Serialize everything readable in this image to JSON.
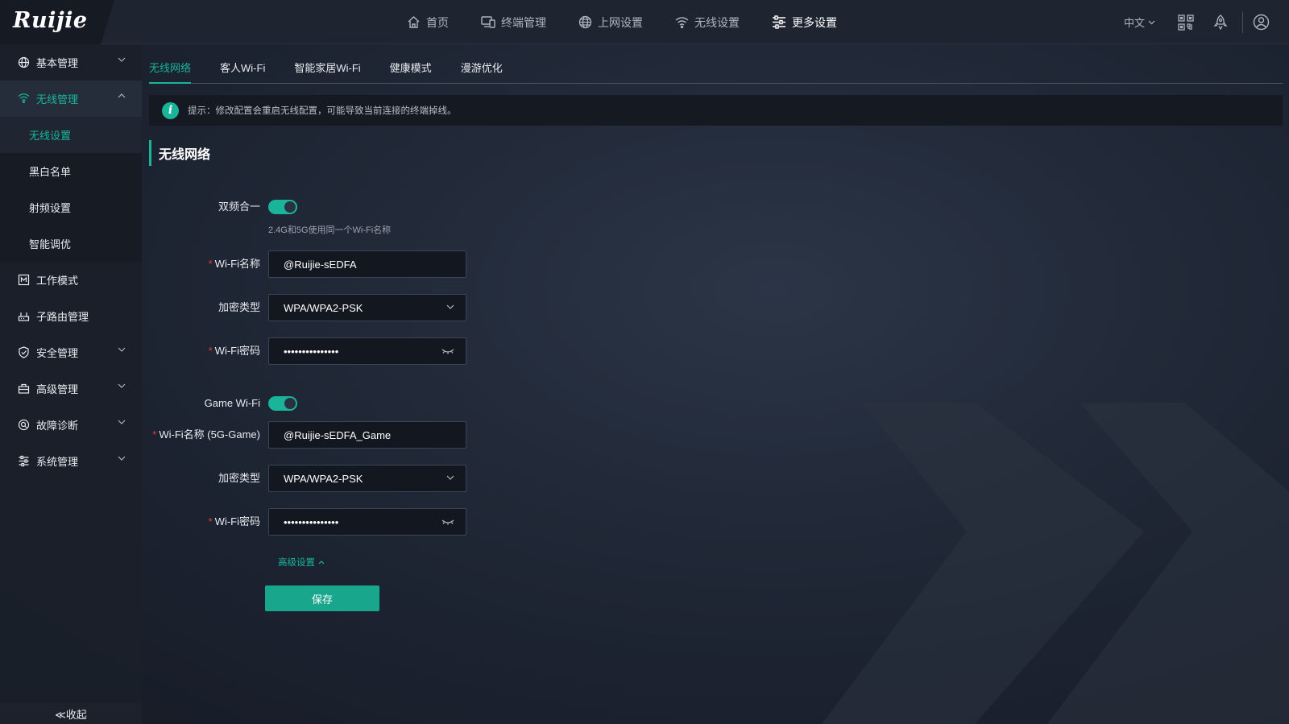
{
  "brand": {
    "logo": "Ruijie"
  },
  "nav": [
    {
      "label": "首页",
      "icon": "home-icon",
      "active": false
    },
    {
      "label": "终端管理",
      "icon": "devices-icon",
      "active": false
    },
    {
      "label": "上网设置",
      "icon": "globe-icon",
      "active": false
    },
    {
      "label": "无线设置",
      "icon": "wifi-icon",
      "active": false
    },
    {
      "label": "更多设置",
      "icon": "settings-sliders-icon",
      "active": true
    }
  ],
  "topright": {
    "language": "中文"
  },
  "sidebar": {
    "items": [
      {
        "label": "基本管理",
        "icon": "globe-icon"
      },
      {
        "label": "无线管理",
        "icon": "wifi-icon",
        "open": true,
        "children": [
          "无线设置",
          "黑白名单",
          "射频设置",
          "智能调优"
        ],
        "active_child": "无线设置"
      },
      {
        "label": "工作模式",
        "icon": "mode-icon"
      },
      {
        "label": "子路由管理",
        "icon": "router-icon"
      },
      {
        "label": "安全管理",
        "icon": "shield-icon"
      },
      {
        "label": "高级管理",
        "icon": "toolbox-icon"
      },
      {
        "label": "故障诊断",
        "icon": "diagnose-icon"
      },
      {
        "label": "系统管理",
        "icon": "system-icon"
      }
    ],
    "collapse_label": "≪收起"
  },
  "tabs": [
    {
      "label": "无线网络",
      "active": true
    },
    {
      "label": "客人Wi-Fi",
      "active": false
    },
    {
      "label": "智能家居Wi-Fi",
      "active": false
    },
    {
      "label": "健康模式",
      "active": false
    },
    {
      "label": "漫游优化",
      "active": false
    }
  ],
  "tip": {
    "text": "提示：修改配置会重启无线配置，可能导致当前连接的终端掉线。"
  },
  "section": {
    "title": "无线网络"
  },
  "form": {
    "dual_band": {
      "label": "双频合一",
      "enabled": true,
      "hint": "2.4G和5G使用同一个Wi-Fi名称"
    },
    "wifi_name": {
      "label": "Wi-Fi名称",
      "required": true,
      "value": "@Ruijie-sEDFA"
    },
    "encryption": {
      "label": "加密类型",
      "value": "WPA/WPA2-PSK"
    },
    "wifi_password": {
      "label": "Wi-Fi密码",
      "required": true,
      "value": "•••••••••••••••"
    },
    "game_wifi": {
      "label": "Game Wi-Fi",
      "enabled": true
    },
    "game_wifi_name": {
      "label": "Wi-Fi名称 (5G-Game)",
      "required": true,
      "value": "@Ruijie-sEDFA_Game"
    },
    "game_encryption": {
      "label": "加密类型",
      "value": "WPA/WPA2-PSK"
    },
    "game_password": {
      "label": "Wi-Fi密码",
      "required": true,
      "value": "•••••••••••••••"
    },
    "advanced_label": "高级设置",
    "save_label": "保存"
  },
  "colors": {
    "accent": "#19b49a",
    "required": "#e0403a",
    "background": "#1d2432"
  }
}
